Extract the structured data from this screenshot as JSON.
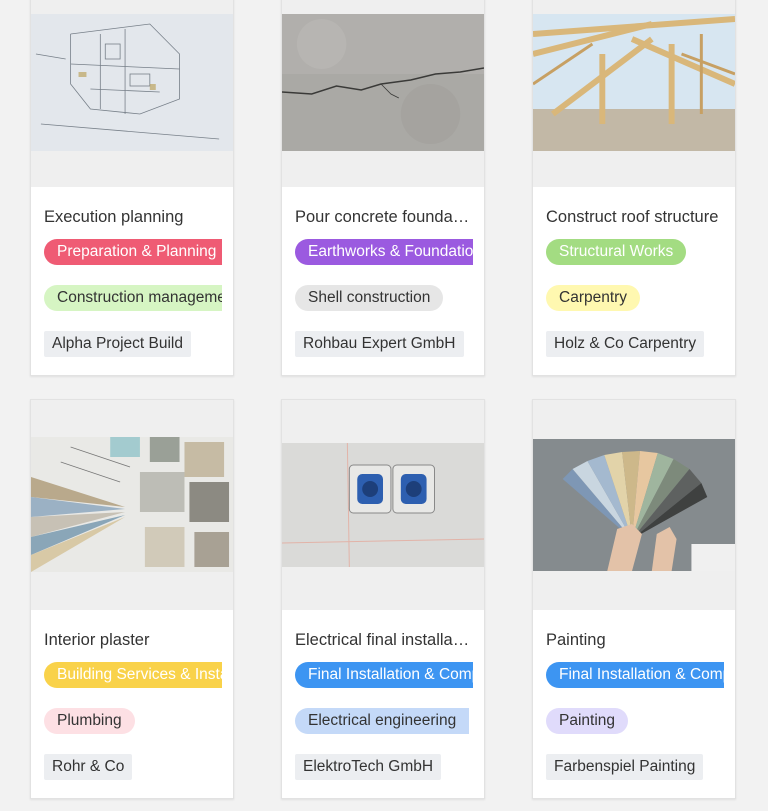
{
  "cards": [
    {
      "title": "Execution planning",
      "phase": {
        "label": "Preparation & Planning",
        "bg": "#ef5b74",
        "fg": "#ffffff"
      },
      "trade": {
        "label": "Construction management",
        "bg": "#d6f5c3",
        "fg": "#333333"
      },
      "company": "Alpha Project Build",
      "image_icon": "blueprint-image"
    },
    {
      "title": "Pour concrete foundation",
      "phase": {
        "label": "Earthworks & Foundation",
        "bg": "#9b5ae0",
        "fg": "#ffffff"
      },
      "trade": {
        "label": "Shell construction",
        "bg": "#e6e6e6",
        "fg": "#333333"
      },
      "company": "Rohbau Expert GmbH",
      "image_icon": "cracked-concrete-image"
    },
    {
      "title": "Construct roof structure",
      "phase": {
        "label": "Structural Works",
        "bg": "#a3dc82",
        "fg": "#ffffff"
      },
      "trade": {
        "label": "Carpentry",
        "bg": "#fff8b0",
        "fg": "#333333"
      },
      "company": "Holz & Co Carpentry",
      "image_icon": "roof-beams-image"
    },
    {
      "title": "Interior plaster",
      "phase": {
        "label": "Building Services & Installation",
        "bg": "#f9d24a",
        "fg": "#ffffff"
      },
      "trade": {
        "label": "Plumbing",
        "bg": "#fde0e4",
        "fg": "#333333"
      },
      "company": "Rohr & Co",
      "image_icon": "material-samples-image"
    },
    {
      "title": "Electrical final installation",
      "phase": {
        "label": "Final Installation & Completion",
        "bg": "#3d95f2",
        "fg": "#ffffff"
      },
      "trade": {
        "label": "Electrical engineering",
        "bg": "#c4d9f8",
        "fg": "#333333"
      },
      "company": "ElektroTech GmbH",
      "image_icon": "wall-sockets-image"
    },
    {
      "title": "Painting",
      "phase": {
        "label": "Final Installation & Completion",
        "bg": "#3d95f2",
        "fg": "#ffffff"
      },
      "trade": {
        "label": "Painting",
        "bg": "#e0dbfb",
        "fg": "#333333"
      },
      "company": "Farbenspiel Painting",
      "image_icon": "color-fan-image"
    }
  ]
}
